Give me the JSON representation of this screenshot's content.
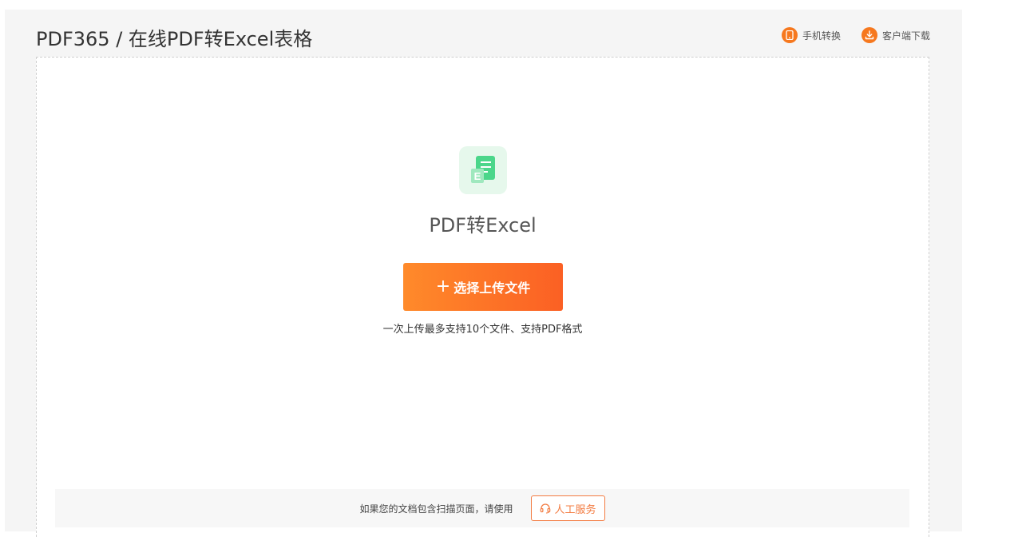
{
  "header": {
    "title": "PDF365 / 在线PDF转Excel表格",
    "links": [
      {
        "label": "手机转换",
        "icon": "phone-icon"
      },
      {
        "label": "客户端下载",
        "icon": "download-icon"
      }
    ]
  },
  "converter": {
    "icon": "excel-doc-icon",
    "tool_name": "PDF转Excel",
    "upload_button": "选择上传文件",
    "upload_icon": "plus-icon",
    "hint": "一次上传最多支持10个文件、支持PDF格式"
  },
  "footer": {
    "text": "如果您的文档包含扫描页面，请使用",
    "service_button": "人工服务",
    "service_icon": "headset-icon"
  },
  "colors": {
    "accent": "#f6781e",
    "excel_green": "#3ecf7a",
    "panel_bg": "#f5f5f5"
  }
}
